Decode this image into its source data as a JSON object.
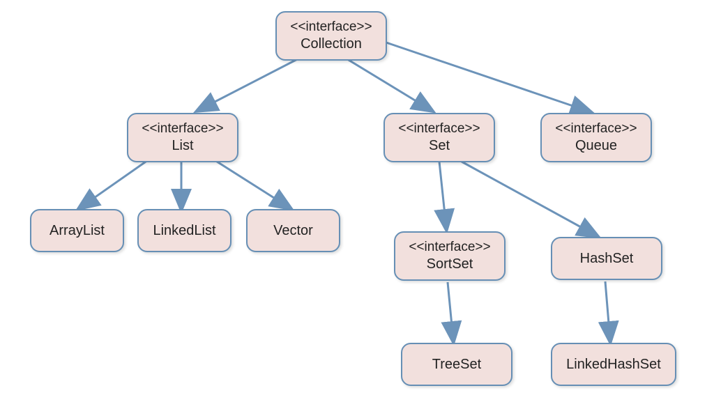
{
  "diagram": {
    "nodes": {
      "collection": {
        "stereotype": "<<interface>>",
        "name": "Collection"
      },
      "list": {
        "stereotype": "<<interface>>",
        "name": "List"
      },
      "set": {
        "stereotype": "<<interface>>",
        "name": "Set"
      },
      "queue": {
        "stereotype": "<<interface>>",
        "name": "Queue"
      },
      "arraylist": {
        "name": "ArrayList"
      },
      "linkedlist": {
        "name": "LinkedList"
      },
      "vector": {
        "name": "Vector"
      },
      "sortset": {
        "stereotype": "<<interface>>",
        "name": "SortSet"
      },
      "hashset": {
        "name": "HashSet"
      },
      "treeset": {
        "name": "TreeSet"
      },
      "linkedhashset": {
        "name": "LinkedHashSet"
      }
    },
    "colors": {
      "nodeFill": "#f2e0dd",
      "nodeBorder": "#668fb5",
      "arrowStroke": "#6c93b9"
    }
  }
}
